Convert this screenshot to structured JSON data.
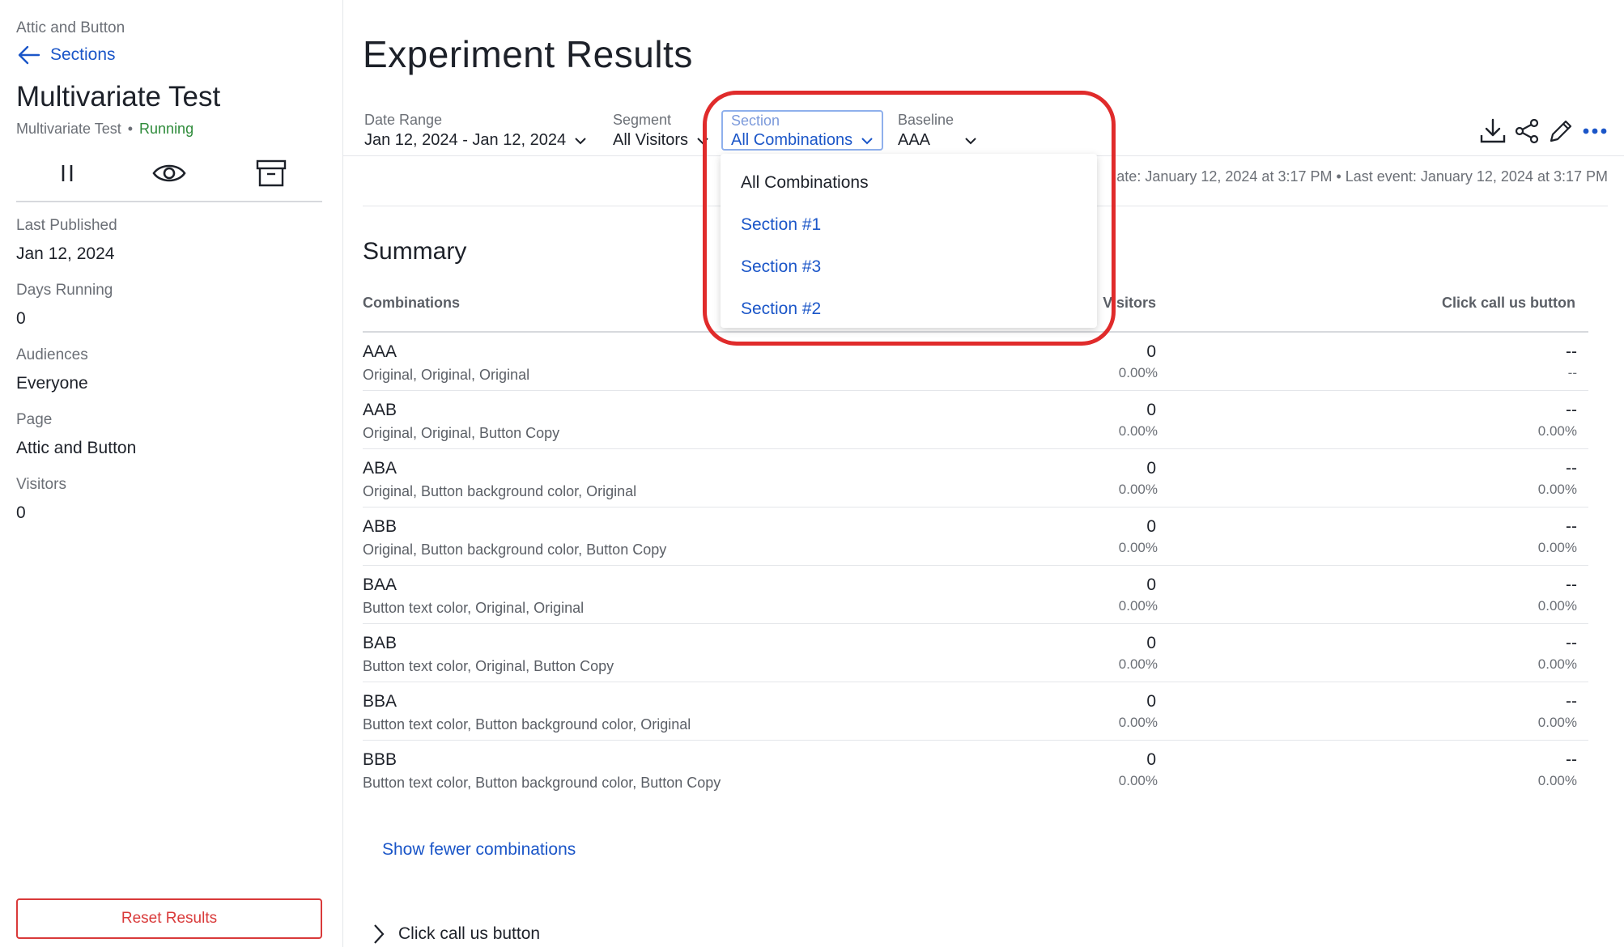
{
  "sidebar": {
    "breadcrumb": "Attic and Button",
    "back_label": "Sections",
    "title": "Multivariate Test",
    "type": "Multivariate Test",
    "separator": "•",
    "status": "Running",
    "actions": [
      "pause-icon",
      "eye-icon",
      "archive-icon"
    ],
    "meta": [
      {
        "label": "Last Published",
        "value": "Jan 12, 2024"
      },
      {
        "label": "Days Running",
        "value": "0"
      },
      {
        "label": "Audiences",
        "value": "Everyone"
      },
      {
        "label": "Page",
        "value": "Attic and Button"
      },
      {
        "label": "Visitors",
        "value": "0"
      }
    ],
    "reset_label": "Reset Results"
  },
  "header": {
    "title": "Experiment Results",
    "filters": {
      "date_range": {
        "label": "Date Range",
        "value": "Jan 12, 2024 - Jan 12, 2024"
      },
      "segment": {
        "label": "Segment",
        "value": "All Visitors"
      },
      "section": {
        "label": "Section",
        "value": "All Combinations"
      },
      "baseline": {
        "label": "Baseline",
        "value": "AAA"
      }
    },
    "toolbar": [
      "download-icon",
      "share-icon",
      "edit-icon",
      "more-icon"
    ],
    "update_line": "ate: January 12, 2024 at 3:17 PM • Last event: January 12, 2024 at 3:17 PM"
  },
  "summary": {
    "title": "Summary",
    "columns": {
      "combinations": "Combinations",
      "visitors": "Visitors",
      "click": "Click call us button"
    },
    "rows": [
      {
        "name": "AAA",
        "desc": "Original, Original, Original",
        "visitors": "0",
        "visitors_pct": "0.00%",
        "click": "--",
        "click_pct": "--"
      },
      {
        "name": "AAB",
        "desc": "Original, Original, Button Copy",
        "visitors": "0",
        "visitors_pct": "0.00%",
        "click": "--",
        "click_pct": "0.00%"
      },
      {
        "name": "ABA",
        "desc": "Original, Button background color, Original",
        "visitors": "0",
        "visitors_pct": "0.00%",
        "click": "--",
        "click_pct": "0.00%"
      },
      {
        "name": "ABB",
        "desc": "Original, Button background color, Button Copy",
        "visitors": "0",
        "visitors_pct": "0.00%",
        "click": "--",
        "click_pct": "0.00%"
      },
      {
        "name": "BAA",
        "desc": "Button text color, Original, Original",
        "visitors": "0",
        "visitors_pct": "0.00%",
        "click": "--",
        "click_pct": "0.00%"
      },
      {
        "name": "BAB",
        "desc": "Button text color, Original, Button Copy",
        "visitors": "0",
        "visitors_pct": "0.00%",
        "click": "--",
        "click_pct": "0.00%"
      },
      {
        "name": "BBA",
        "desc": "Button text color, Button background color, Original",
        "visitors": "0",
        "visitors_pct": "0.00%",
        "click": "--",
        "click_pct": "0.00%"
      },
      {
        "name": "BBB",
        "desc": "Button text color, Button background color, Button Copy",
        "visitors": "0",
        "visitors_pct": "0.00%",
        "click": "--",
        "click_pct": "0.00%"
      }
    ],
    "show_fewer": "Show fewer combinations",
    "metric_section": "Click call us button"
  },
  "dropdown": {
    "options": [
      "All Combinations",
      "Section #1",
      "Section #3",
      "Section #2"
    ],
    "selected": "All Combinations"
  },
  "colors": {
    "link": "#1b56c8",
    "running": "#2e8b3a",
    "danger": "#d93a3a",
    "highlight": "#e02b2b"
  }
}
